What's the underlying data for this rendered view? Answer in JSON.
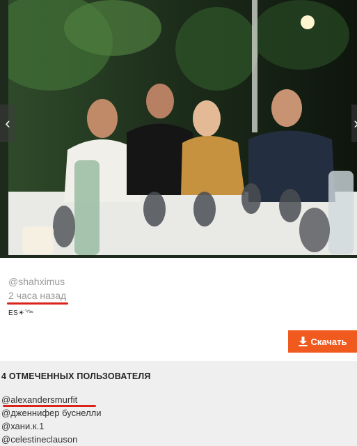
{
  "post": {
    "username": "@shahximus",
    "time_ago": "2 часа назад",
    "caption": "ES☀︎𓆝"
  },
  "actions": {
    "download_label": "Скачать"
  },
  "tagged": {
    "title": "4 ОТМЕЧЕННЫХ ПОЛЬЗОВАТЕЛЯ",
    "users": [
      "@alexandersmurfit",
      "@дженнифер буснелли",
      "@хани.к.1",
      "@celestineclauson"
    ]
  },
  "colors": {
    "accent": "#f05a1f",
    "underline": "#d9241b",
    "panel_bg": "#efefef"
  },
  "icons": {
    "prev": "chevron-left-icon",
    "next": "chevron-right-icon",
    "download": "download-icon"
  }
}
